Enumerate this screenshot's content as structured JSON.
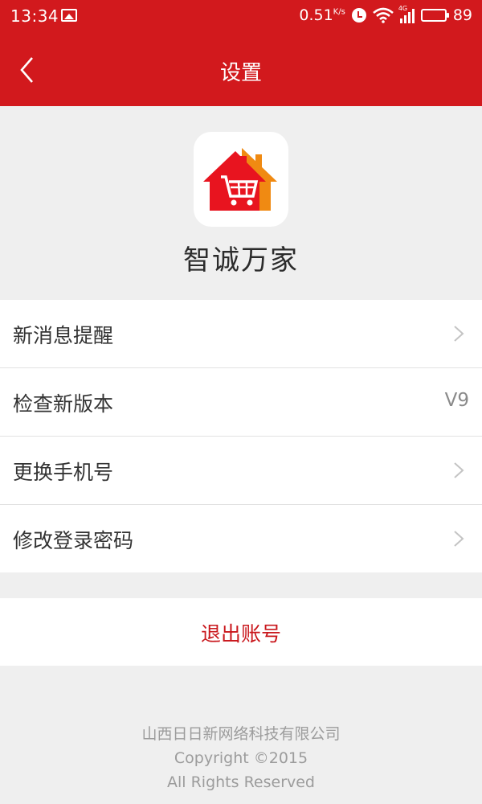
{
  "status_bar": {
    "time": "13:34",
    "speed": "0.51",
    "speed_unit": "K/s",
    "network_tag": "4G",
    "battery": "89",
    "battery_level": 0.89
  },
  "header": {
    "title": "设置"
  },
  "app": {
    "name": "智诚万家"
  },
  "menu": {
    "items": [
      {
        "label": "新消息提醒",
        "value": ""
      },
      {
        "label": "检查新版本",
        "value": "V9"
      },
      {
        "label": "更换手机号",
        "value": ""
      },
      {
        "label": "修改登录密码",
        "value": ""
      }
    ]
  },
  "logout": {
    "label": "退出账号"
  },
  "footer": {
    "company": "山西日日新网络科技有限公司",
    "copyright": "Copyright ©2015",
    "rights": "All Rights Reserved"
  },
  "colors": {
    "brand": "#d2191d",
    "logo_red": "#e8141f",
    "logo_orange": "#f08a12",
    "background": "#efefef"
  }
}
